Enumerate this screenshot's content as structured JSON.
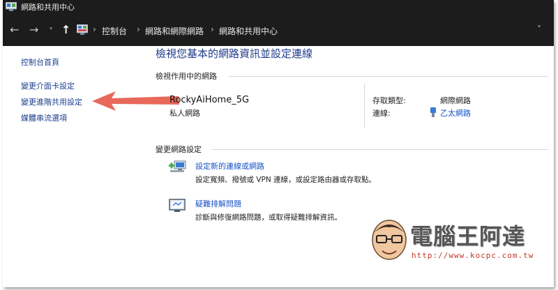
{
  "window": {
    "title": "網路和共用中心",
    "icon": "network-center-icon"
  },
  "navigation": {
    "back": "←",
    "forward": "→",
    "recent": "˅",
    "up": "↑",
    "breadcrumbs": [
      "控制台",
      "網路和網際網路",
      "網路和共用中心"
    ],
    "separator": "›",
    "expand": "˅"
  },
  "sidebar": {
    "items": [
      "控制台首頁",
      "變更介面卡設定",
      "變更進階共用設定",
      "媒體串流選項"
    ]
  },
  "main": {
    "title": "檢視您基本的網路資訊並設定連線",
    "active_networks_label": "檢視作用中的網路",
    "network": {
      "name": "RockyAiHome_5G",
      "type": "私人網路",
      "access_type_label": "存取類型:",
      "access_type_value": "網際網路",
      "connection_label": "連線:",
      "connection_value": "乙太網路"
    },
    "change_settings_label": "變更網路設定",
    "tasks": [
      {
        "icon": "new-connection-icon",
        "title": "設定新的連線或網路",
        "description": "設定寬頻、撥號或 VPN 連線，或設定路由器或存取點。"
      },
      {
        "icon": "troubleshoot-icon",
        "title": "疑難排解問題",
        "description": "診斷與修復網路問題，或取得疑難排解資訊。"
      }
    ]
  },
  "watermark": {
    "title": "電腦王阿達",
    "url": "http://www.kocpc.com.tw"
  },
  "colors": {
    "titlebar_bg": "#1c1c1c",
    "link": "#1a52c6",
    "sidebar_link": "#1a3f8f",
    "heading": "#1e3a8a",
    "arrow": "#e8685a"
  }
}
